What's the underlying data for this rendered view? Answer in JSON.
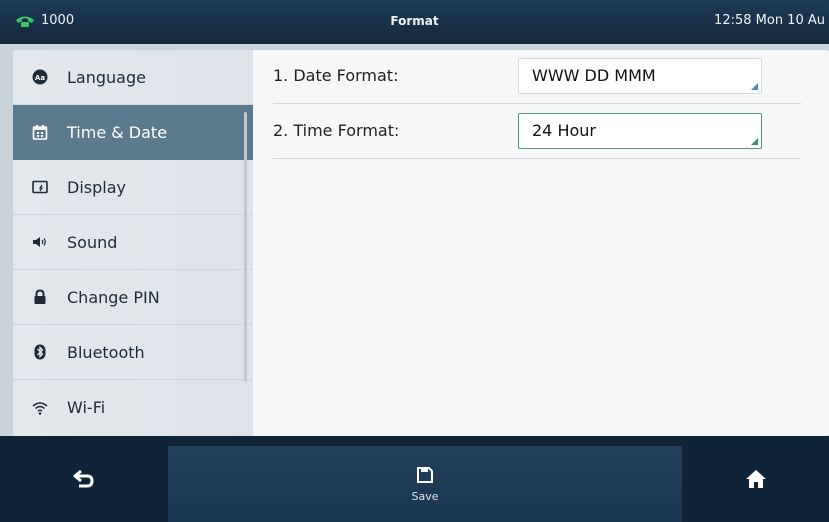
{
  "statusbar": {
    "line_number": "1000",
    "title": "Format",
    "datetime": "12:58 Mon 10 Au"
  },
  "sidebar": {
    "items": [
      {
        "label": "Language",
        "icon": "language-icon"
      },
      {
        "label": "Time & Date",
        "icon": "calendar-icon",
        "active": true
      },
      {
        "label": "Display",
        "icon": "display-icon"
      },
      {
        "label": "Sound",
        "icon": "speaker-icon"
      },
      {
        "label": "Change PIN",
        "icon": "lock-icon"
      },
      {
        "label": "Bluetooth",
        "icon": "bluetooth-icon"
      },
      {
        "label": "Wi-Fi",
        "icon": "wifi-icon"
      }
    ]
  },
  "settings": [
    {
      "label": "1. Date Format:",
      "value": "WWW DD MMM"
    },
    {
      "label": "2. Time Format:",
      "value": "24 Hour",
      "focused": true
    }
  ],
  "bottombar": {
    "save_label": "Save"
  },
  "colors": {
    "active_item": "#5c7a8d",
    "statusbar": "#1f3b56",
    "bottombar": "#0f2438",
    "focus_border": "#4e9a73"
  }
}
